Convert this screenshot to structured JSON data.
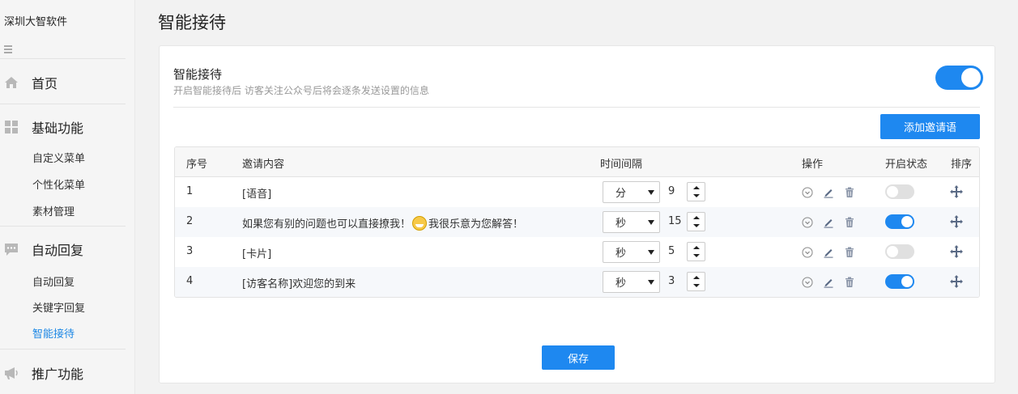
{
  "sidebar": {
    "brand": "深圳大智软件",
    "sections": [
      {
        "label": "首页",
        "icon": "home-icon"
      },
      {
        "label": "基础功能",
        "icon": "grid-icon"
      },
      {
        "label": "自动回复",
        "icon": "chat-icon"
      },
      {
        "label": "推广功能",
        "icon": "megaphone-icon"
      }
    ],
    "basic_items": [
      "自定义菜单",
      "个性化菜单",
      "素材管理"
    ],
    "reply_items": [
      "自动回复",
      "关键字回复",
      "智能接待"
    ],
    "active_item": "智能接待"
  },
  "page": {
    "title": "智能接待"
  },
  "setting": {
    "title": "智能接待",
    "description": "开启智能接待后 访客关注公众号后将会逐条发送设置的信息",
    "enabled": true
  },
  "add_button": "添加邀请语",
  "table": {
    "headers": [
      "序号",
      "邀请内容",
      "时间间隔",
      "操作",
      "开启状态",
      "排序"
    ],
    "rows": [
      {
        "index": "1",
        "content": "[语音]",
        "content_after": "",
        "unit": "分",
        "interval": "9",
        "enabled": false
      },
      {
        "index": "2",
        "content": "如果您有别的问题也可以直接撩我！",
        "content_after": "我很乐意为您解答！",
        "unit": "秒",
        "interval": "15",
        "enabled": true
      },
      {
        "index": "3",
        "content": "[卡片]",
        "content_after": "",
        "unit": "秒",
        "interval": "5",
        "enabled": false
      },
      {
        "index": "4",
        "content": "[访客名称]欢迎您的到来",
        "content_after": "",
        "unit": "秒",
        "interval": "3",
        "enabled": true
      }
    ]
  },
  "save_button": "保存",
  "colors": {
    "accent": "#1e88f0",
    "active_text": "#1e88e5",
    "toggle_off": "#e0e0e0"
  }
}
